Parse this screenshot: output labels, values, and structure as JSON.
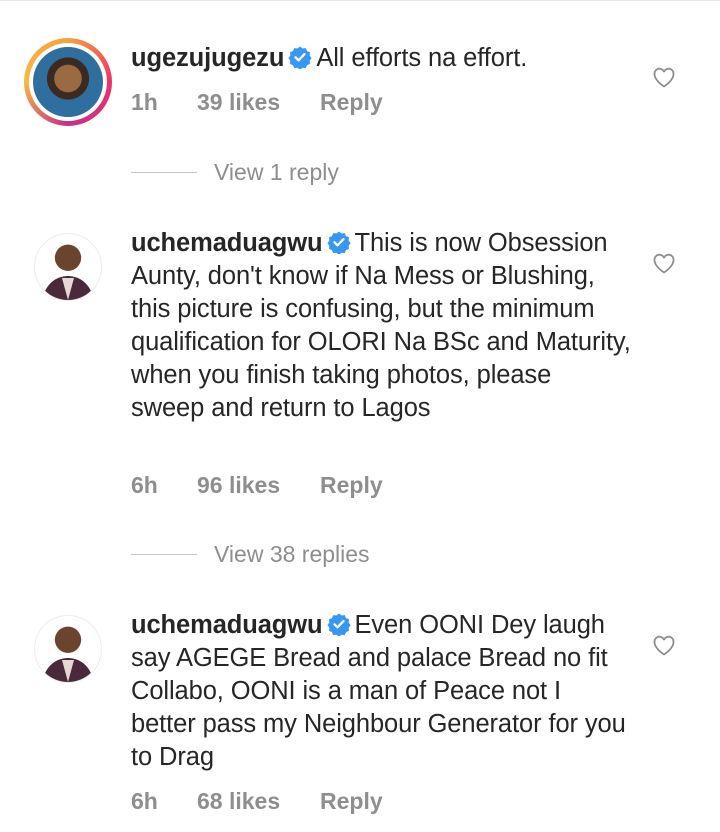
{
  "comments": [
    {
      "username": "ugezujugezu",
      "text": "All efforts na effort.",
      "time": "1h",
      "likes": "39 likes",
      "reply_label": "Reply",
      "view_replies": "View 1 reply"
    },
    {
      "username": "uchemaduagwu",
      "text": "This is now Obsession Aunty, don't know if Na Mess or Blushing, this picture is confusing, but the minimum qualification for OLORI Na BSc and Maturity, when you finish taking photos, please sweep and return to Lagos",
      "time": "6h",
      "likes": "96 likes",
      "reply_label": "Reply",
      "view_replies": "View 38 replies"
    },
    {
      "username": "uchemaduagwu",
      "text": "Even OONI Dey laugh say AGEGE Bread and palace Bread no fit Collabo, OONI is a man of Peace not I better pass my Neighbour Generator for you to Drag",
      "time": "6h",
      "likes": "68 likes",
      "reply_label": "Reply"
    }
  ],
  "colors": {
    "verified": "#3897f0",
    "muted": "#8e8e8e",
    "text": "#262626"
  },
  "icons": {
    "verified": "verified-badge-icon",
    "like": "heart-outline-icon"
  }
}
